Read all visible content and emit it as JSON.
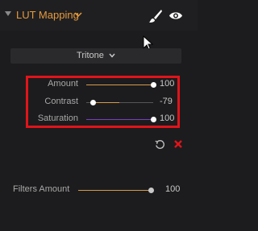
{
  "header": {
    "title": "LUT Mapping",
    "title_color": "#e69a3c",
    "collapse_icon": "triangle-down-icon",
    "chevron_icon": "chevron-down-icon",
    "brush_icon": "paintbrush-icon",
    "visibility_icon": "eye-icon"
  },
  "preset": {
    "selected": "Tritone",
    "icon": "chevron-down-icon"
  },
  "sliders": [
    {
      "label": "Amount",
      "value": "100",
      "level": 1.0,
      "fill_from": 0.0,
      "fill_color": "#d49a4e"
    },
    {
      "label": "Contrast",
      "value": "-79",
      "level": 0.105,
      "fill_from": 0.105,
      "fill_to": 0.5,
      "fill_color": "#d49a4e"
    },
    {
      "label": "Saturation",
      "value": "100",
      "level": 1.0,
      "fill_from": 0.0,
      "fill_color": "#7a3fbf"
    }
  ],
  "actions": {
    "reset_icon": "reset-icon",
    "close_icon": "close-icon",
    "close_color": "#e0141a"
  },
  "filters_amount": {
    "label": "Filters Amount",
    "value": "100",
    "level": 1.0
  },
  "highlight_color": "#e0141a"
}
